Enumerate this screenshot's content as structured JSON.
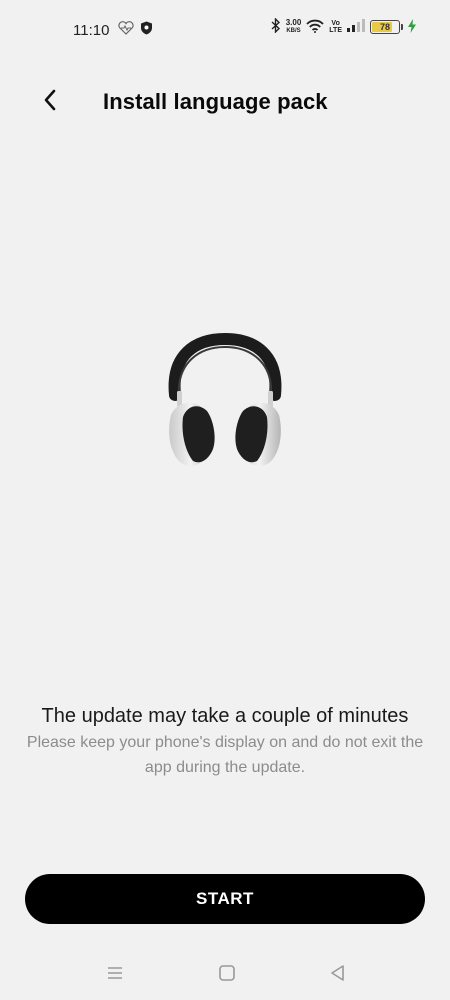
{
  "status_bar": {
    "time": "11:10",
    "speed_value": "3.00",
    "speed_unit": "KB/S",
    "volte_top": "Vo",
    "volte_bottom": "LTE",
    "battery_level": "78",
    "battery_fraction": 0.78,
    "battery_color": "#e8c94a",
    "icons": [
      "heart-rate-icon",
      "shield-icon",
      "bluetooth-icon",
      "wifi-icon",
      "signal-icon",
      "charging-icon"
    ]
  },
  "header": {
    "title": "Install language pack",
    "back_icon": "chevron-left-icon"
  },
  "message": {
    "title": "The update may take a couple of minutes",
    "body": "Please keep your phone's display on and do not exit the app during the update."
  },
  "actions": {
    "start_label": "START"
  },
  "nav_bar": {
    "icons": [
      "menu-icon",
      "home-icon",
      "back-icon"
    ]
  }
}
